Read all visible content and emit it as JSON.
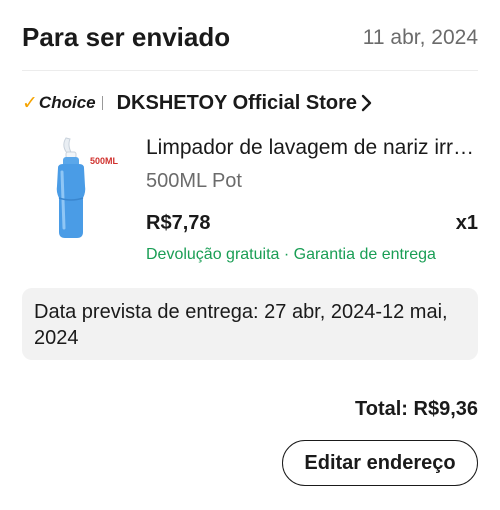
{
  "header": {
    "status_title": "Para ser enviado",
    "date": "11 abr, 2024"
  },
  "store": {
    "badge_label": "Choice",
    "name": "DKSHETOY Official Store",
    "accent_color": "#f5a300"
  },
  "product": {
    "title": "Limpador de lavagem de nariz irrigador nasal",
    "variant": "500ML Pot",
    "price": "R$7,78",
    "quantity": "x1",
    "tags": "Devolução gratuita · Garantia de entrega",
    "image_label": "500ML",
    "tag_color": "#1a9e55"
  },
  "delivery": {
    "text": "Data prevista de entrega: 27 abr, 2024-12 mai, 2024"
  },
  "order": {
    "total": "Total: R$9,36"
  },
  "actions": {
    "edit_address_label": "Editar endereço"
  }
}
